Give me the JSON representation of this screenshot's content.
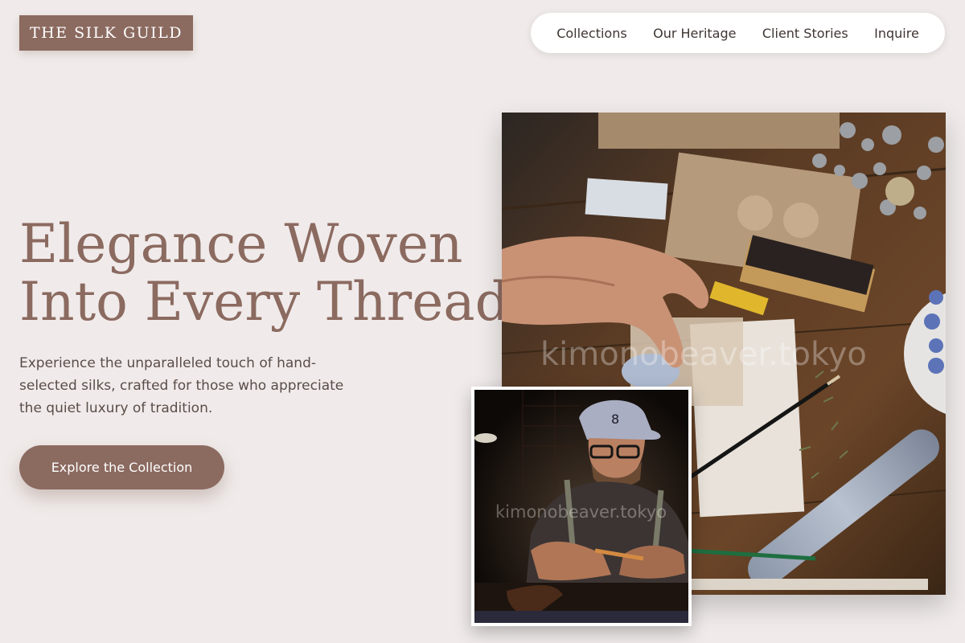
{
  "brand": {
    "logo_text": "THE SILK GUILD"
  },
  "nav": {
    "items": [
      {
        "label": "Collections"
      },
      {
        "label": "Our Heritage"
      },
      {
        "label": "Client Stories"
      },
      {
        "label": "Inquire"
      }
    ]
  },
  "hero": {
    "title_line1": "Elegance Woven",
    "title_line2": "Into Every Thread.",
    "subtitle": "Experience the unparalleled touch of hand-selected silks, crafted for those who appreciate the quiet luxury of tradition.",
    "cta_label": "Explore the Collection"
  },
  "images": {
    "main_watermark": "kimonobeaver.tokyo",
    "inset_watermark": "kimonobeaver.tokyo"
  },
  "colors": {
    "background": "#f0ebea",
    "accent": "#8b6a60",
    "nav_background": "#ffffff",
    "text_dark": "#3f3532"
  }
}
